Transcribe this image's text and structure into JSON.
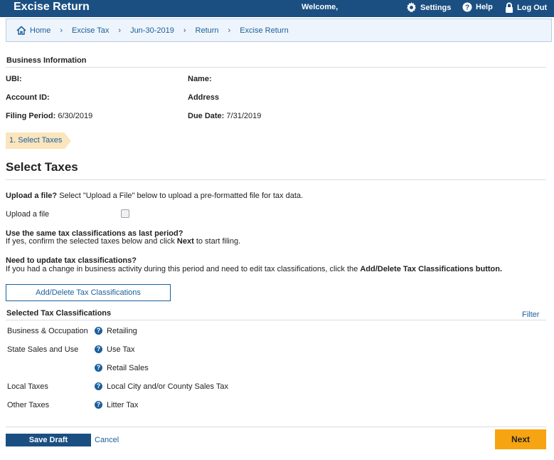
{
  "header": {
    "app_title": "Excise Return",
    "welcome": "Welcome,",
    "settings_label": "Settings",
    "help_label": "Help",
    "logout_label": "Log Out"
  },
  "breadcrumb": [
    "Home",
    "Excise Tax",
    "Jun-30-2019",
    "Return",
    "Excise Return"
  ],
  "business_info": {
    "title": "Business Information",
    "ubi_label": "UBI:",
    "name_label": "Name:",
    "account_label": "Account ID:",
    "address_label": "Address",
    "filing_period_label": "Filing Period:",
    "filing_period_value": "6/30/2019",
    "due_date_label": "Due Date:",
    "due_date_value": "7/31/2019"
  },
  "step": {
    "label": "1. Select Taxes"
  },
  "page": {
    "heading": "Select Taxes",
    "upload_question_bold": "Upload a file?",
    "upload_question_text": "Select \"Upload a File\" below to upload a pre-formatted file for tax data.",
    "upload_checkbox_label": "Upload a file",
    "same_class_bold": "Use the same tax classifications as last period?",
    "same_class_text_pre": "If yes, confirm the selected taxes below and click",
    "same_class_text_bold": "Next",
    "same_class_text_post": "to start filing.",
    "update_bold": "Need to update tax classifications?",
    "update_text_pre": "If you had a change in business activity during this period and need to edit tax classifications, click the",
    "update_text_bold": "Add/Delete Tax Classifications button.",
    "add_delete_button": "Add/Delete Tax Classifications",
    "selected_title": "Selected Tax Classifications",
    "filter_label": "Filter"
  },
  "tax_rows": [
    {
      "category": "Business & Occupation",
      "tax": "Retailing"
    },
    {
      "category": "State Sales and Use",
      "tax": "Use Tax"
    },
    {
      "category": "",
      "tax": "Retail Sales"
    },
    {
      "category": "Local Taxes",
      "tax": "Local City and/or County Sales Tax"
    },
    {
      "category": "Other Taxes",
      "tax": "Litter Tax"
    }
  ],
  "footer": {
    "save_draft": "Save Draft",
    "cancel": "Cancel",
    "next": "Next"
  },
  "colors": {
    "header_bg": "#1b4f82",
    "link": "#1a5f9c",
    "step_bg": "#fae5bd",
    "next_button": "#f7a412"
  }
}
